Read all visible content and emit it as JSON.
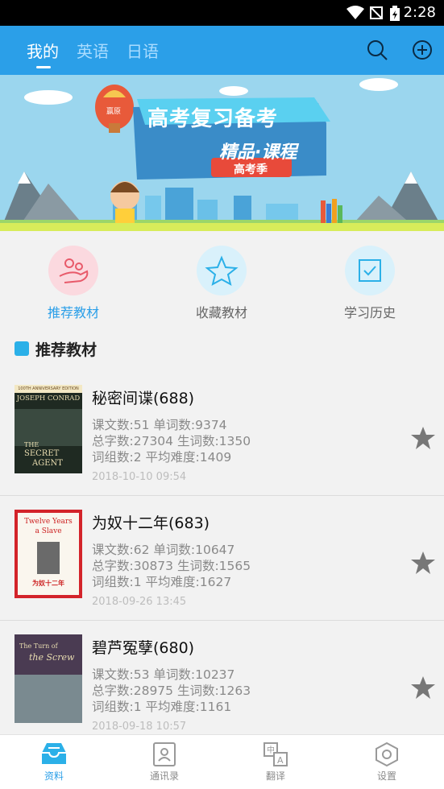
{
  "status_bar": {
    "time": "2:28"
  },
  "header": {
    "tabs": [
      {
        "label": "我的",
        "active": true
      },
      {
        "label": "英语",
        "active": false
      },
      {
        "label": "日语",
        "active": false
      }
    ],
    "icons": [
      "search-icon",
      "add-circle-icon"
    ]
  },
  "banner": {
    "title": "高考复习备考",
    "subtitle": "精品·课程",
    "tag": "高考季",
    "balloon_text": "赢原"
  },
  "quick_actions": [
    {
      "label": "推荐教材",
      "icon": "hand-people-icon",
      "active": true
    },
    {
      "label": "收藏教材",
      "icon": "star-icon",
      "active": false
    },
    {
      "label": "学习历史",
      "icon": "check-book-icon",
      "active": false
    }
  ],
  "section": {
    "title": "推荐教材"
  },
  "books": [
    {
      "title": "秘密间谍(688)",
      "line1": "课文数:51 单词数:9374",
      "line2": "总字数:27304 生词数:1350",
      "line3": "词组数:2 平均难度:1409",
      "date": "2018-10-10 09:54",
      "cover_top": "100TH ANNIVERSARY EDITION",
      "cover_author": "JOSEPH CONRAD",
      "cover_title1": "THE",
      "cover_title2": "SECRET",
      "cover_title3": "AGENT"
    },
    {
      "title": "为奴十二年(683)",
      "line1": "课文数:62 单词数:10647",
      "line2": "总字数:30873 生词数:1565",
      "line3": "词组数:1 平均难度:1627",
      "date": "2018-09-26 13:45",
      "cover_title1": "Twelve Years",
      "cover_title2": "a Slave",
      "cover_cn": "为奴十二年"
    },
    {
      "title": "碧芦冤孽(680)",
      "line1": "课文数:53 单词数:10237",
      "line2": "总字数:28975 生词数:1263",
      "line3": "词组数:1 平均难度:1161",
      "date": "2018-09-18 10:57",
      "cover_title1": "The Turn of",
      "cover_title2": "the Screw"
    }
  ],
  "bottom_nav": [
    {
      "label": "资料",
      "icon": "inbox-icon",
      "active": true
    },
    {
      "label": "通讯录",
      "icon": "contacts-icon",
      "active": false
    },
    {
      "label": "翻译",
      "icon": "translate-icon",
      "active": false
    },
    {
      "label": "设置",
      "icon": "settings-icon",
      "active": false
    }
  ],
  "colors": {
    "primary": "#2b9fe8",
    "active_text": "#2b9fe8",
    "banner_sky": "#9bd6ee"
  }
}
